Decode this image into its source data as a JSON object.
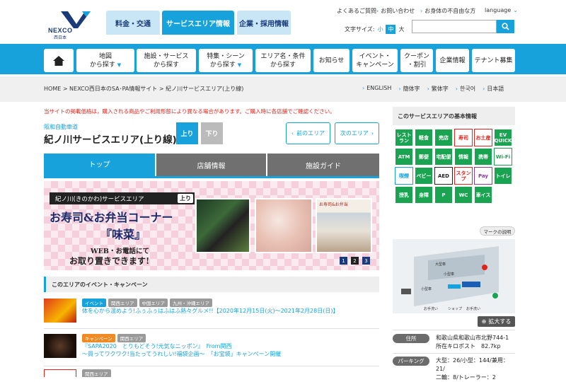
{
  "logo": {
    "text": "NEXCO",
    "sub": "西日本"
  },
  "top_tabs": [
    "料金・交通",
    "サービスエリア情報",
    "企業・採用情報"
  ],
  "util_links": [
    "よくあるご質問",
    "お問い合わせ",
    "お身体の不自由な方",
    "language"
  ],
  "font_size": {
    "label": "文字サイズ:",
    "small": "小",
    "medium": "中",
    "large": "大"
  },
  "search": {
    "placeholder": ""
  },
  "nav": {
    "map": [
      "地図",
      "から探す"
    ],
    "facility": [
      "施設・サービス",
      "から探す"
    ],
    "feature": [
      "特集・シーン",
      "から探す"
    ],
    "area": [
      "エリア名・条件",
      "から探す"
    ],
    "news": "お知らせ",
    "event": [
      "イベント・",
      "キャンペーン"
    ],
    "coupon": [
      "クーポン",
      "・割引"
    ],
    "company": "企業情報",
    "tenant": "テナント募集"
  },
  "breadcrumb": "HOME > NEXCO西日本のSA･PA情報サイト > 紀ノ川サービスエリア(上り線)",
  "languages": [
    "ENGLISH",
    "簡体字",
    "繁体字",
    "한국어",
    "日本語"
  ],
  "notice": "当サイトの掲載価格は，購入される商品やご利用形態により異なる場合があります。ご購入時に各店舗でご確認ください。",
  "road": "阪和自動車道",
  "title": "紀ノ川サービスエリア(上り線)",
  "direction": {
    "up": "上り",
    "down": "下り"
  },
  "prev_area": "前のエリア",
  "next_area": "次のエリア",
  "content_tabs": [
    "トップ",
    "店舗情報",
    "施設ガイド"
  ],
  "banner": {
    "head": "紀ノ川(きのかわ)サービスエリア",
    "updown": "上り",
    "main": "お寿司&お弁当コーナー",
    "name": "『味菜』",
    "sub1": "WEB・お電話にて",
    "sub2": "お取り置きできます!",
    "photo_text": "お寿司&お弁当",
    "dots": [
      "1",
      "2",
      "3"
    ]
  },
  "events_heading": "このエリアのイベント・キャンペーン",
  "events": [
    {
      "tags": [
        {
          "t": "イベント",
          "c": "blue"
        },
        {
          "t": "関西エリア",
          "c": "gray"
        },
        {
          "t": "中国エリア",
          "c": "gray"
        },
        {
          "t": "九州・沖縄エリア",
          "c": "gray"
        }
      ],
      "text": [
        "体を心から温めよう!ふぅふぅはふはふ熱々グルメ!!【2020年12月15日(火)～2021年2月28日(日)】"
      ]
    },
    {
      "tags": [
        {
          "t": "キャンペーン",
          "c": "orange"
        },
        {
          "t": "関西エリア",
          "c": "gray"
        }
      ],
      "text": [
        "『SAPA2020　とりもどそう!元気なニッポン』　From関西",
        "～買ってワクワク!当たってうれしい!福袋企画～　「お宝袋」キャンペーン開催"
      ]
    },
    {
      "tags": [
        {
          "t": "関西エリア",
          "c": "gray"
        }
      ],
      "text": [
        ""
      ]
    }
  ],
  "sidebar": {
    "heading": "このサービスエリアの基本情報",
    "icons": [
      "レストラン",
      "軽食",
      "売店",
      "寿司",
      "お土産",
      "EV QUICK",
      "ATM",
      "郵便",
      "宅配便",
      "情報",
      "携帯",
      "Wi-Fi",
      "喫煙",
      "ベビー",
      "AED",
      "スタンプ",
      "Pay",
      "トイレ",
      "授乳",
      "身障",
      "P",
      "WC",
      "車イス"
    ],
    "legend": "マークの説明",
    "zoom": "拡大する",
    "map_labels": [
      "大型車",
      "小型車",
      "小型車",
      "お手洗い",
      "ショップ",
      "お手洗い"
    ],
    "address_label": "住所",
    "address": [
      "和歌山県和歌山市北野744-1",
      "所在キロポスト　82.7kp"
    ],
    "parking_label": "パーキング",
    "parking": [
      "大型：26/小型：144/兼用：21/",
      "二輪：8/トレーラー：2"
    ]
  }
}
